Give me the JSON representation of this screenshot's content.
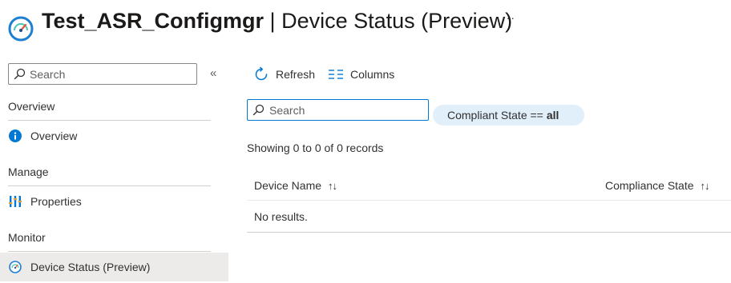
{
  "header": {
    "resource_name": "Test_ASR_Configmgr",
    "separator": "|",
    "page_name": "Device Status (Preview)",
    "more_label": "···",
    "icon": "gauge-icon"
  },
  "sidebar": {
    "search_placeholder": "Search",
    "collapse_label": "«",
    "sections": [
      {
        "title": "Overview",
        "items": [
          {
            "label": "Overview",
            "icon": "info-icon",
            "active": false
          }
        ]
      },
      {
        "title": "Manage",
        "items": [
          {
            "label": "Properties",
            "icon": "properties-icon",
            "active": false
          }
        ]
      },
      {
        "title": "Monitor",
        "items": [
          {
            "label": "Device Status (Preview)",
            "icon": "gauge-icon",
            "active": true
          }
        ]
      }
    ]
  },
  "toolbar": {
    "refresh_label": "Refresh",
    "columns_label": "Columns"
  },
  "main": {
    "search_placeholder": "Search",
    "filter": {
      "field": "Compliant State ==",
      "value": "all"
    },
    "records_text": "Showing 0 to 0 of 0 records",
    "table": {
      "columns": [
        "Device Name",
        "Compliance State"
      ],
      "sort_glyph": "↑↓",
      "empty_text": "No results."
    }
  },
  "colors": {
    "accent": "#0078d4",
    "pill_bg": "#e1effa",
    "active_nav_bg": "#edebe9"
  }
}
